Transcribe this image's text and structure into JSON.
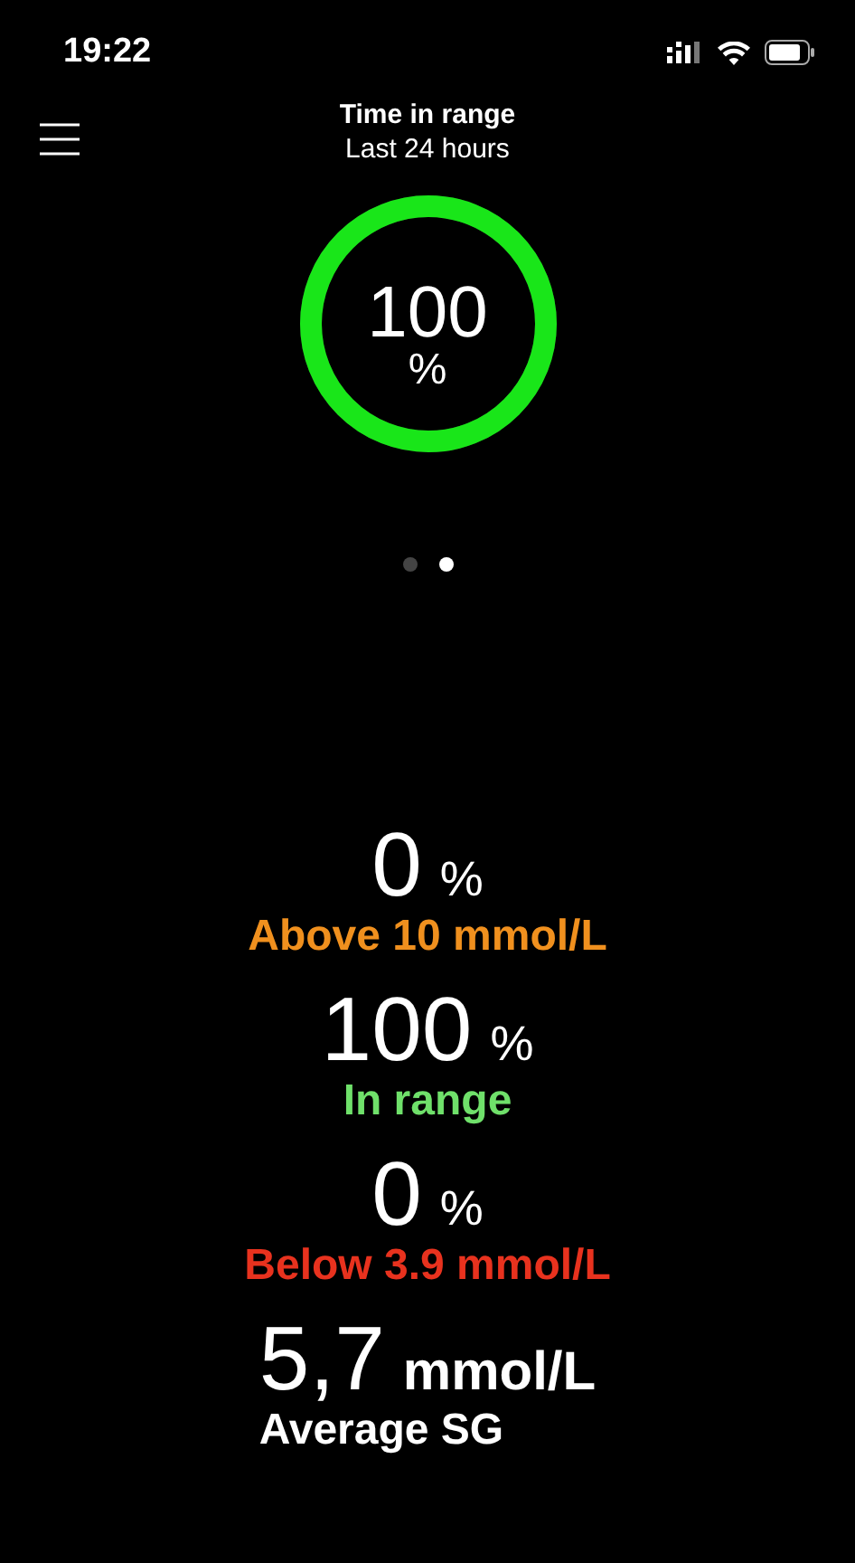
{
  "status_bar": {
    "time": "19:22"
  },
  "header": {
    "title": "Time in range",
    "subtitle": "Last 24 hours"
  },
  "ring": {
    "value": "100",
    "unit": "%",
    "level": 1,
    "color": "#19e619"
  },
  "pages": [
    {
      "selected": false
    },
    {
      "selected": true
    }
  ],
  "stats": [
    {
      "kind": "percent",
      "value": "0",
      "unit": "%",
      "label": "Above 10 mmol/L",
      "color": "#f0901e"
    },
    {
      "kind": "percent",
      "value": "100",
      "unit": "%",
      "label": "In range",
      "color": "#6fe06a"
    },
    {
      "kind": "percent",
      "value": "0",
      "unit": "%",
      "label": "Below 3.9 mmol/L",
      "color": "#e8321e"
    },
    {
      "kind": "average",
      "value": "5,7",
      "unit": "mmol/L",
      "label": "Average SG",
      "color": "#ffffff"
    }
  ]
}
